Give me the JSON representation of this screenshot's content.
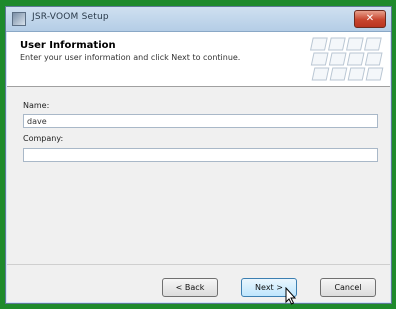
{
  "window": {
    "title": "JSR-VOOM Setup",
    "close_glyph": "✕"
  },
  "header": {
    "title": "User Information",
    "subtitle": "Enter your user information and click Next to continue."
  },
  "form": {
    "name_label": "Name:",
    "name_value": "dave",
    "company_label": "Company:",
    "company_value": ""
  },
  "buttons": {
    "back_label": "< Back",
    "next_label": "Next >",
    "cancel_label": "Cancel"
  },
  "colors": {
    "desktop": "#1e8a2c",
    "default_button": "#bee6fd",
    "close_button": "#c8452e"
  }
}
